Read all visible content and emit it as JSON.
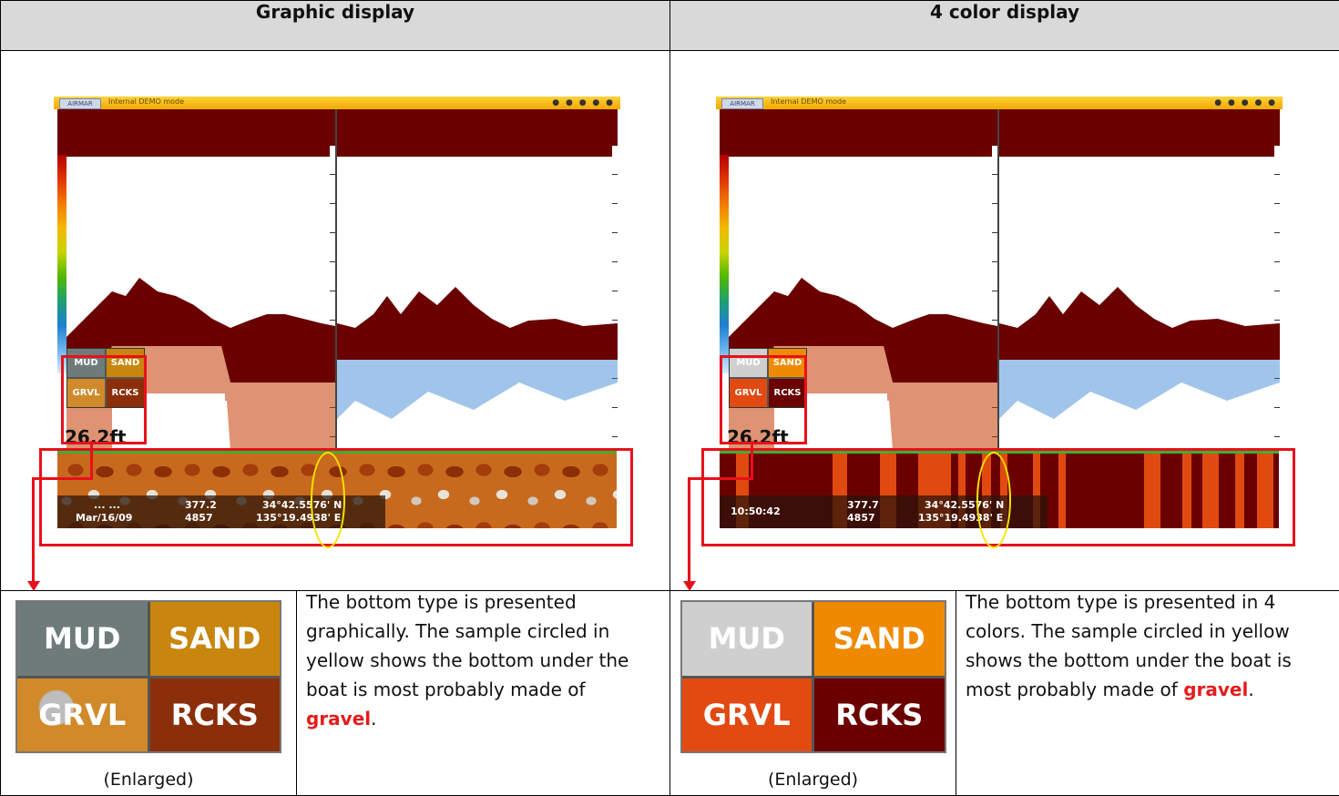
{
  "headers": {
    "left": "Graphic display",
    "right": "4 color display"
  },
  "screen": {
    "title": "Internal DEMO mode",
    "logo": "AIRMAR",
    "depth": "26.2ft",
    "legend": [
      "MUD",
      "SAND",
      "GRVL",
      "RCKS"
    ]
  },
  "left_status": {
    "time": "... ...",
    "date": "Mar/16/09",
    "trip": "377.2",
    "odo": "4857",
    "lat": "34°42.5576' N",
    "lon": "135°19.4938' E"
  },
  "right_status": {
    "time": "10:50:42",
    "trip": "377.7",
    "odo": "4857",
    "lat": "34°42.5576' N",
    "lon": "135°19.4938' E"
  },
  "colors": {
    "mud_graphic": "#6f7b7a",
    "sand_graphic": "#c8860f",
    "grvl_graphic": "#d08a2a",
    "rcks_graphic": "#8a2f0a",
    "mud_4color": "#cfcfcf",
    "sand_4color": "#ef8a00",
    "grvl_4color": "#e24a12",
    "rcks_4color": "#6b0000",
    "highlight": "#e8101a",
    "circle": "#f5e400"
  },
  "captions": {
    "enlarged": "(Enlarged)",
    "left_pre": "The bottom type is presented graphically. The sample circled in yellow shows the bottom under the boat is most probably made of ",
    "left_bold": "gravel",
    "left_post": ".",
    "right_pre": "The bottom type is presented in 4 colors. The sample circled in yellow shows the bottom under the boat is most probably made of ",
    "right_bold": "gravel",
    "right_post": "."
  }
}
